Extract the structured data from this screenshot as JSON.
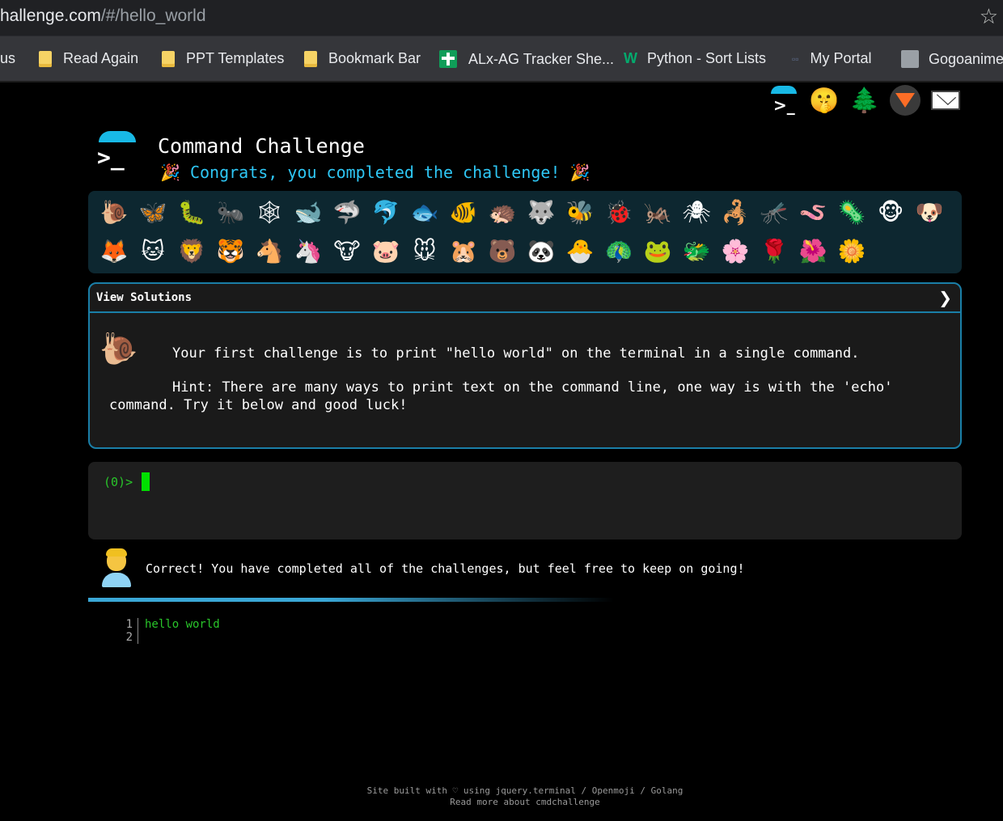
{
  "browser": {
    "url_main": "hallenge.com",
    "url_path": "/#/hello_world",
    "star_icon": "☆",
    "bookmarks": [
      {
        "label": "us",
        "icon": "none"
      },
      {
        "label": "Read Again",
        "icon": "folder-icon"
      },
      {
        "label": "PPT Templates",
        "icon": "folder-icon"
      },
      {
        "label": "Bookmark Bar",
        "icon": "folder-icon"
      },
      {
        "label": "ALx-AG Tracker She...",
        "icon": "sheets-icon"
      },
      {
        "label": "Python - Sort Lists",
        "icon": "w3-icon"
      },
      {
        "label": "My Portal",
        "icon": "portal-icon"
      },
      {
        "label": "Gogoanime",
        "icon": "globe-icon"
      }
    ]
  },
  "header": {
    "title": "Command Challenge",
    "congrats": "Congrats, you completed the challenge!",
    "party_emoji": "🎉",
    "accent_color": "#18b9e6"
  },
  "top_icons": [
    "logo-icon",
    "shushing-face-icon",
    "tree-icon",
    "gitlab-icon",
    "mail-icon"
  ],
  "animals_row1": [
    "🐌",
    "🦋",
    "🐛",
    "🐜",
    "🕸",
    "🐋",
    "🦈",
    "🐬",
    "🐟",
    "🐠",
    "🦔",
    "🐺",
    "🐝",
    "🐞",
    "🦗",
    "🕷",
    "🦂",
    "🦟",
    "🪱",
    "🦠",
    "🐵",
    "🐶"
  ],
  "animals_row2": [
    "🦊",
    "🐱",
    "🦁",
    "🐯",
    "🐴",
    "🦄",
    "🐮",
    "🐷",
    "🐭",
    "🐹",
    "🐻",
    "🐼",
    "🐣",
    "🦚",
    "🐸",
    "🐲",
    "🌸",
    "🌹",
    "🌺",
    "🌼"
  ],
  "challenge": {
    "toggle_label": "View Solutions",
    "chevron": "❯",
    "text": "Your first challenge is to print \"hello world\" on the terminal in a single command.",
    "hint_line1": "Hint: There are many ways to print text on the command line, one way is with the 'echo'",
    "hint_line2": "command. Try it below and good luck!"
  },
  "terminal": {
    "prompt": "(0)>"
  },
  "result": {
    "message": "Correct! You have completed all of the challenges, but feel free to keep on going!"
  },
  "editor": {
    "lines": [
      {
        "n": "1",
        "text": "hello world"
      },
      {
        "n": "2",
        "text": ""
      }
    ]
  },
  "footer": {
    "line1": "Site built with ♡ using jquery.terminal / Openmoji / Golang",
    "line2": "Read more about cmdchallenge"
  }
}
